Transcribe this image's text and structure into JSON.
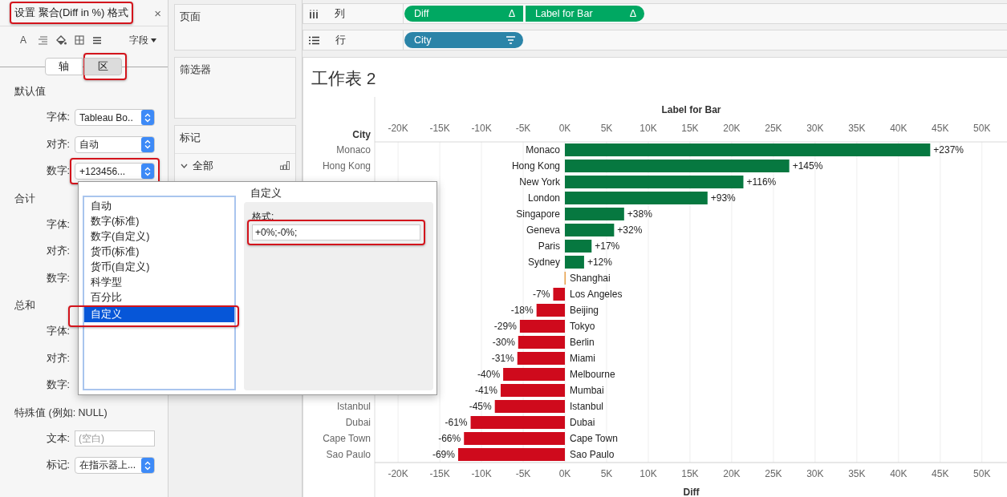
{
  "format_panel": {
    "title": "设置 聚合(Diff in %) 格式",
    "title_highlighted": true,
    "close": "×",
    "font_icon": "A",
    "field_menu": "字段",
    "tabs": [
      {
        "label": "轴",
        "selected": false
      },
      {
        "label": "区",
        "selected": true,
        "highlighted": true
      }
    ],
    "sections": [
      {
        "heading": "默认值",
        "rows": [
          {
            "label": "字体:",
            "kind": "dropdown",
            "value": "Tableau Bo.."
          },
          {
            "label": "对齐:",
            "kind": "dropdown",
            "value": "自动"
          },
          {
            "label": "数字:",
            "kind": "dropdown",
            "value": "+123456...",
            "highlighted": true
          }
        ]
      },
      {
        "heading": "合计",
        "rows": [
          {
            "label": "字体:",
            "kind": "covered"
          },
          {
            "label": "对齐:",
            "kind": "covered"
          },
          {
            "label": "数字:",
            "kind": "covered"
          }
        ]
      },
      {
        "heading": "总和",
        "rows": [
          {
            "label": "字体:",
            "kind": "covered"
          },
          {
            "label": "对齐:",
            "kind": "covered"
          },
          {
            "label": "数字:",
            "kind": "covered"
          }
        ]
      },
      {
        "heading": "特殊值 (例如: NULL)",
        "rows": [
          {
            "label": "文本:",
            "kind": "text",
            "placeholder": "(空白)"
          },
          {
            "label": "标记:",
            "kind": "dropdown",
            "value": "在指示器上..."
          }
        ]
      }
    ]
  },
  "cards": [
    {
      "title": "页面"
    },
    {
      "title": "筛选器"
    },
    {
      "title": "标记",
      "rows": [
        {
          "label": "全部"
        }
      ]
    }
  ],
  "shelves": [
    {
      "label": "列",
      "kind": "columns",
      "pills": [
        {
          "text": "Diff",
          "marker": "Δ",
          "color": "#00a862"
        },
        {
          "text": "Label for Bar",
          "marker": "Δ",
          "color": "#00a862"
        }
      ]
    },
    {
      "label": "行",
      "kind": "rows",
      "pills": [
        {
          "text": "City",
          "sorted": true,
          "color": "#2b84a8"
        }
      ]
    }
  ],
  "worksheet": {
    "title": "工作表 2",
    "row_header": "City",
    "row_labels_top": [
      "Monaco",
      "Hong Kong"
    ],
    "row_labels_bottom": [
      "Istanbul",
      "Dubai",
      "Cape Town",
      "Sao Paulo"
    ],
    "top_axis": {
      "title": "Label for Bar",
      "ticks": [
        "-20K",
        "-15K",
        "-10K",
        "-5K",
        "0K",
        "5K",
        "10K",
        "15K",
        "20K",
        "25K",
        "30K",
        "35K",
        "40K",
        "45K",
        "50K"
      ]
    },
    "percent_labels": [
      "+237%",
      "+145%",
      "+116%",
      "+93%",
      "+38%",
      "+32%",
      "+17%",
      "+12%",
      "-7%",
      "-18%",
      "-29%",
      "-30%",
      "-31%",
      "-40%",
      "-41%",
      "-45%",
      "-61%",
      "-66%",
      "-69%"
    ],
    "chart_data": {
      "type": "bar",
      "orientation": "horizontal",
      "xlabel": "Diff",
      "grid": true,
      "categories": [
        "Monaco",
        "Hong Kong",
        "New York",
        "London",
        "Singapore",
        "Geneva",
        "Paris",
        "Sydney",
        "Shanghai",
        "Los Angeles",
        "Beijing",
        "Tokyo",
        "Berlin",
        "Miami",
        "Melbourne",
        "Mumbai",
        "Istanbul",
        "Dubai",
        "Cape Town",
        "Sao Paulo"
      ],
      "values": [
        43800,
        26900,
        21400,
        17100,
        7100,
        5900,
        3200,
        2300,
        0,
        -1400,
        -3400,
        -5400,
        -5600,
        -5700,
        -7400,
        -7700,
        -8400,
        -11300,
        -12100,
        -12800
      ],
      "xlim": [
        -22800,
        53100
      ],
      "xticks": [
        {
          "value": -20000,
          "label": "-20K"
        },
        {
          "value": -15000,
          "label": "-15K"
        },
        {
          "value": -10000,
          "label": "-10K"
        },
        {
          "value": -5000,
          "label": "-5K"
        },
        {
          "value": 0,
          "label": "0K"
        },
        {
          "value": 5000,
          "label": "5K"
        },
        {
          "value": 10000,
          "label": "10K"
        },
        {
          "value": 15000,
          "label": "15K"
        },
        {
          "value": 20000,
          "label": "20K"
        },
        {
          "value": 25000,
          "label": "25K"
        },
        {
          "value": 30000,
          "label": "30K"
        },
        {
          "value": 35000,
          "label": "35K"
        },
        {
          "value": 40000,
          "label": "40K"
        },
        {
          "value": 45000,
          "label": "45K"
        },
        {
          "value": 50000,
          "label": "50K"
        }
      ]
    }
  },
  "popup": {
    "categories": [
      {
        "label": "自动",
        "selected": false
      },
      {
        "label": "数字(标准)",
        "selected": false
      },
      {
        "label": "数字(自定义)",
        "selected": false
      },
      {
        "label": "货币(标准)",
        "selected": false
      },
      {
        "label": "货币(自定义)",
        "selected": false
      },
      {
        "label": "科学型",
        "selected": false
      },
      {
        "label": "百分比",
        "selected": false
      },
      {
        "label": "自定义",
        "selected": true,
        "highlighted": true
      }
    ],
    "detail_title": "自定义",
    "format_label": "格式:",
    "format_value": "+0%;-0%;",
    "format_highlighted": true
  }
}
